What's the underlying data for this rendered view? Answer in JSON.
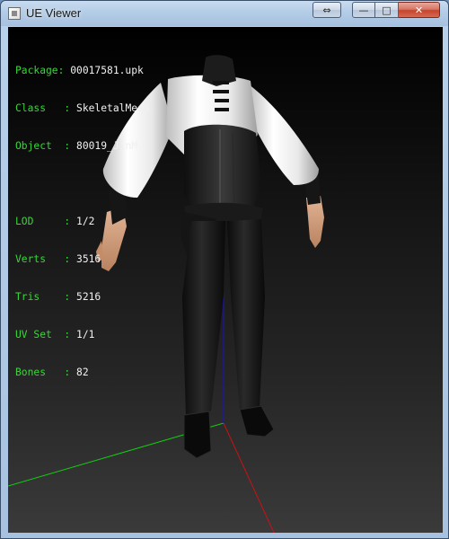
{
  "window": {
    "title": "UE Viewer",
    "buttons": {
      "swap_glyph": "⇔",
      "minimize_glyph": "—",
      "maximize_glyph": "□",
      "close_glyph": "✕"
    }
  },
  "info_panel": {
    "package_label": "Package",
    "package_value": "00017581.upk",
    "class_label": "Class",
    "class_value": "SkeletalMesh",
    "object_label": "Object",
    "object_value": "80019_JinM",
    "lod_label": "LOD",
    "lod_value": "1/2",
    "verts_label": "Verts",
    "verts_value": "3516",
    "tris_label": "Tris",
    "tris_value": "5216",
    "uvset_label": "UV Set",
    "uvset_value": "1/1",
    "bones_label": "Bones",
    "bones_value": "82"
  },
  "colors": {
    "label": "#39d639",
    "value": "#f0f0f0",
    "axis_x": "#cc1111",
    "axis_y": "#11cc11",
    "axis_z": "#1414cc"
  }
}
